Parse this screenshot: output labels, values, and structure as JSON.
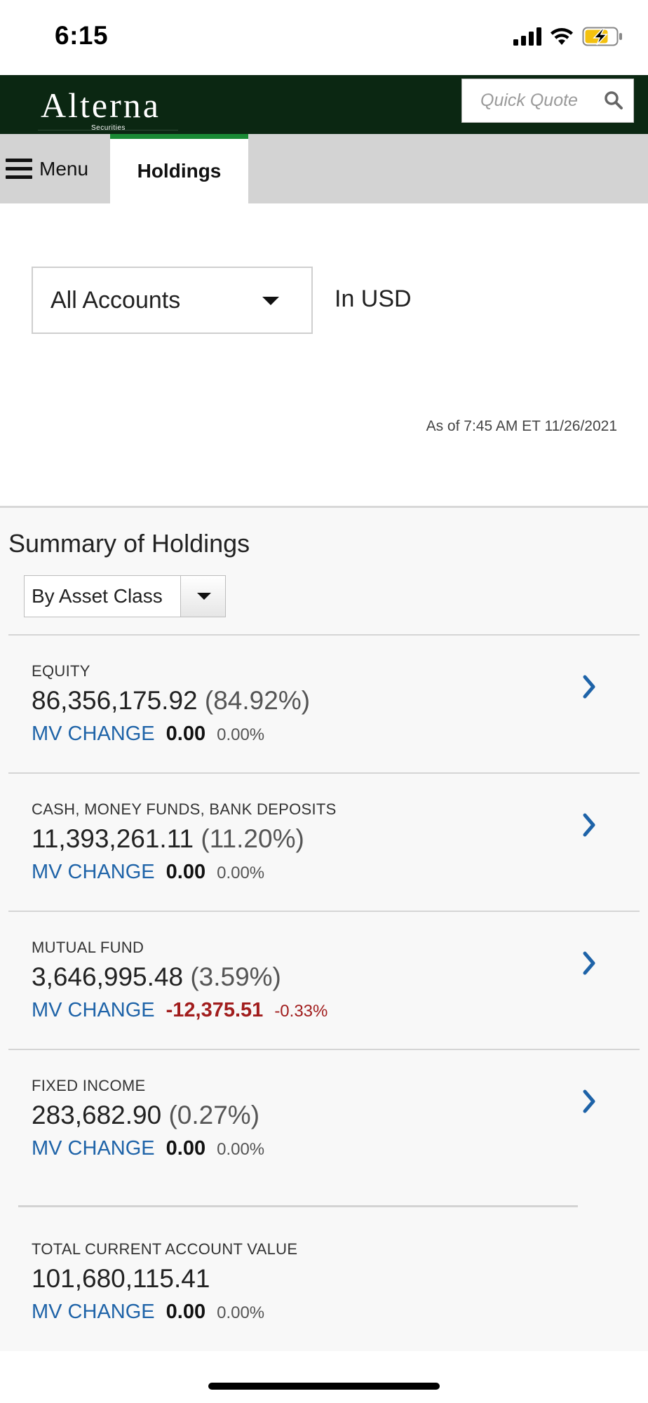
{
  "status_bar": {
    "time": "6:15"
  },
  "header": {
    "logo": "Alterna",
    "logo_sub": "Securities",
    "quick_quote_placeholder": "Quick Quote"
  },
  "tabs": {
    "menu_label": "Menu",
    "active_tab": "Holdings"
  },
  "account": {
    "selected": "All Accounts",
    "currency": "In USD"
  },
  "as_of": "As of  7:45 AM ET 11/26/2021",
  "summary": {
    "title": "Summary of Holdings",
    "group_by": "By Asset Class",
    "mv_change_label": "MV CHANGE",
    "holdings": [
      {
        "category": "EQUITY",
        "value": "86,356,175.92",
        "percent": "(84.92%)",
        "mv_change": "0.00",
        "mv_change_pct": "0.00%"
      },
      {
        "category": "CASH, MONEY FUNDS, BANK DEPOSITS",
        "value": "11,393,261.11",
        "percent": "(11.20%)",
        "mv_change": "0.00",
        "mv_change_pct": "0.00%"
      },
      {
        "category": "MUTUAL FUND",
        "value": "3,646,995.48",
        "percent": "(3.59%)",
        "mv_change": "-12,375.51",
        "mv_change_pct": "-0.33%"
      },
      {
        "category": "FIXED INCOME",
        "value": "283,682.90",
        "percent": "(0.27%)",
        "mv_change": "0.00",
        "mv_change_pct": "0.00%"
      }
    ],
    "total": {
      "category": "TOTAL CURRENT ACCOUNT VALUE",
      "value": "101,680,115.41",
      "mv_change": "0.00",
      "mv_change_pct": "0.00%"
    }
  },
  "colors": {
    "header_bg": "#0b2712",
    "accent_green": "#1a8a35",
    "link_blue": "#1e63a8",
    "negative_red": "#a11d1d"
  }
}
